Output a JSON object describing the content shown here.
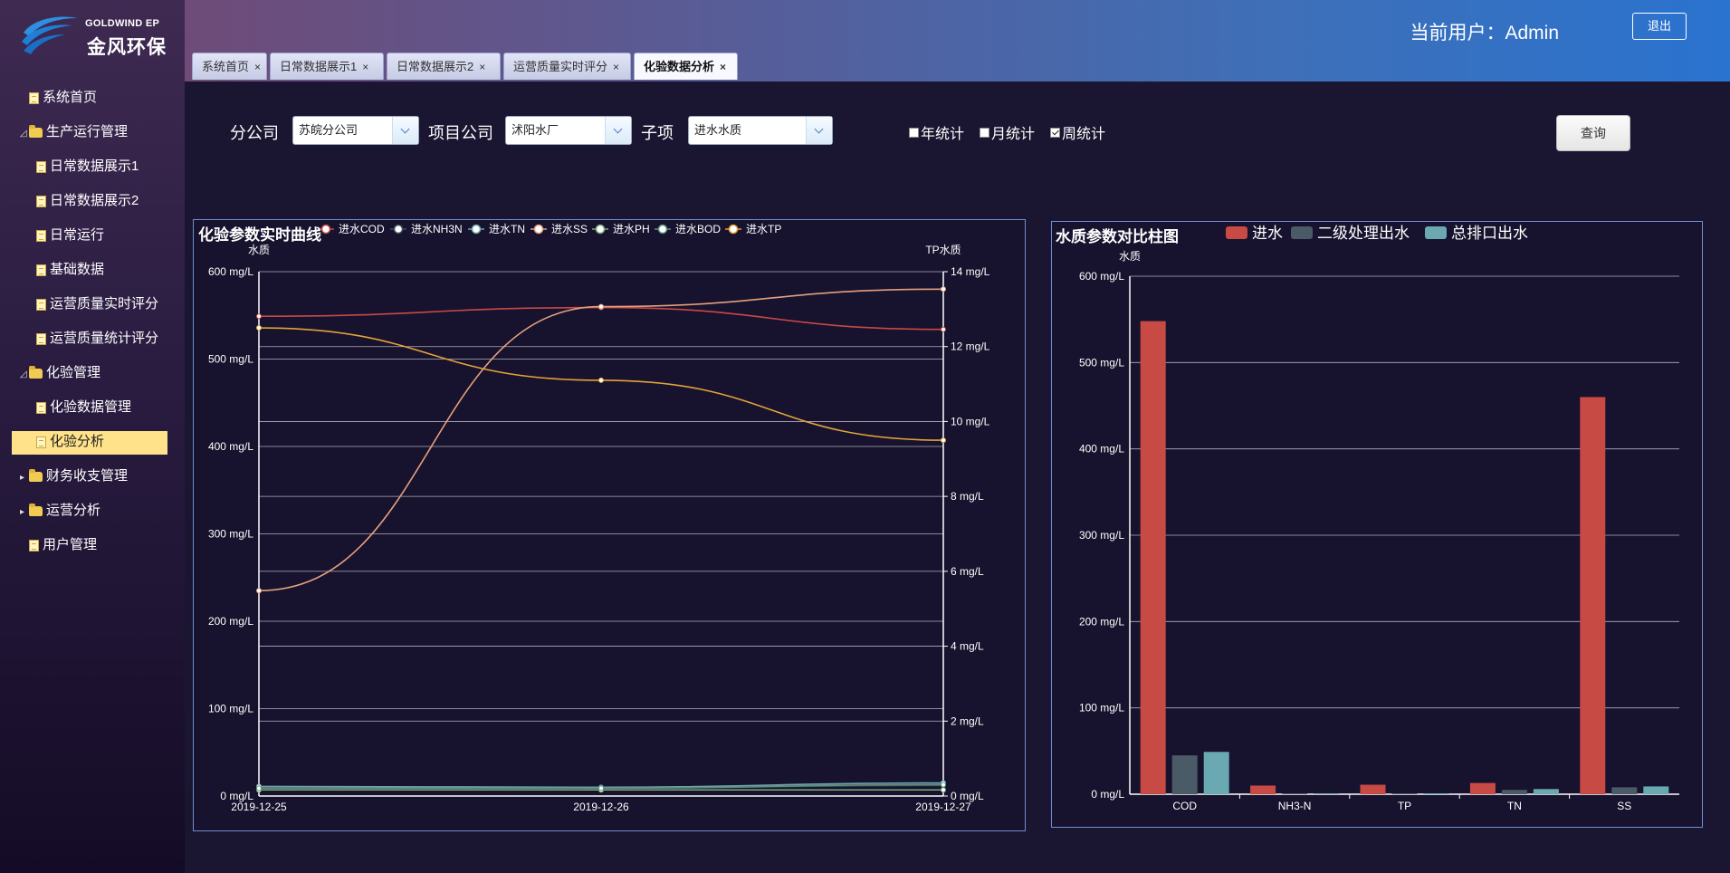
{
  "brand": {
    "en": "GOLDWIND EP",
    "cn": "金风环保"
  },
  "header": {
    "user_label": "当前用户：Admin",
    "logout_label": "退出"
  },
  "sidebar": {
    "items": [
      {
        "label": "系统首页",
        "type": "file",
        "level": 0
      },
      {
        "label": "生产运行管理",
        "type": "folder-open",
        "level": 0,
        "arrow": "◿"
      },
      {
        "label": "日常数据展示1",
        "type": "file",
        "level": 1
      },
      {
        "label": "日常数据展示2",
        "type": "file",
        "level": 1
      },
      {
        "label": "日常运行",
        "type": "file",
        "level": 1
      },
      {
        "label": "基础数据",
        "type": "file",
        "level": 1
      },
      {
        "label": "运营质量实时评分",
        "type": "file",
        "level": 1
      },
      {
        "label": "运营质量统计评分",
        "type": "file",
        "level": 1
      },
      {
        "label": "化验管理",
        "type": "folder-open",
        "level": 0,
        "arrow": "◿"
      },
      {
        "label": "化验数据管理",
        "type": "file",
        "level": 1
      },
      {
        "label": "化验分析",
        "type": "file",
        "level": 1,
        "active": true
      },
      {
        "label": "财务收支管理",
        "type": "folder",
        "level": 0,
        "arrow": "▸"
      },
      {
        "label": "运营分析",
        "type": "folder",
        "level": 0,
        "arrow": "▸"
      },
      {
        "label": "用户管理",
        "type": "file",
        "level": 0
      }
    ]
  },
  "tabs": [
    {
      "label": "系统首页"
    },
    {
      "label": "日常数据展示1"
    },
    {
      "label": "日常数据展示2"
    },
    {
      "label": "运营质量实时评分"
    },
    {
      "label": "化验数据分析",
      "active": true
    }
  ],
  "filters": {
    "branch_label": "分公司",
    "branch_value": "苏皖分公司",
    "project_label": "项目公司",
    "project_value": "沭阳水厂",
    "sub_label": "子项",
    "sub_value": "进水水质",
    "year_label": "年统计",
    "month_label": "月统计",
    "week_label": "周统计",
    "year_checked": false,
    "month_checked": false,
    "week_checked": true,
    "query_label": "查询"
  },
  "line_panel": {
    "title": "化验参数实时曲线"
  },
  "bar_panel": {
    "title": "水质参数对比柱图"
  },
  "chart_data": [
    {
      "type": "line",
      "title": "化验参数实时曲线",
      "x": [
        "2019-12-25",
        "2019-12-26",
        "2019-12-27"
      ],
      "y_left": {
        "label": "水质",
        "ticks": [
          "0 mg/L",
          "100 mg/L",
          "200 mg/L",
          "300 mg/L",
          "400 mg/L",
          "500 mg/L",
          "600 mg/L"
        ],
        "lim": [
          0,
          600
        ]
      },
      "y_right": {
        "label": "TP水质",
        "ticks": [
          "0 mg/L",
          "2 mg/L",
          "4 mg/L",
          "6 mg/L",
          "8 mg/L",
          "10 mg/L",
          "12 mg/L",
          "14 mg/L"
        ],
        "lim": [
          0,
          14
        ]
      },
      "legend_position": "top",
      "grid": true,
      "series": [
        {
          "name": "进水COD",
          "axis": "left",
          "color": "#c84a45",
          "values": [
            549,
            559,
            534
          ]
        },
        {
          "name": "进水NH3N",
          "axis": "left",
          "color": "#3c4f5c",
          "values": [
            10,
            9,
            12
          ]
        },
        {
          "name": "进水TN",
          "axis": "left",
          "color": "#6ba5ad",
          "values": [
            11,
            10,
            15
          ]
        },
        {
          "name": "进水SS",
          "axis": "left",
          "color": "#e4a07e",
          "values": [
            235,
            560,
            580
          ]
        },
        {
          "name": "进水PH",
          "axis": "left",
          "color": "#7ea97a",
          "values": [
            7,
            7,
            7
          ]
        },
        {
          "name": "进水BOD",
          "axis": "left",
          "color": "#5e8f7f",
          "values": [
            9,
            9,
            13
          ]
        },
        {
          "name": "进水TP",
          "axis": "right",
          "color": "#e3a33a",
          "values": [
            12.5,
            11.1,
            9.5
          ]
        }
      ]
    },
    {
      "type": "bar",
      "title": "水质参数对比柱图",
      "categories": [
        "COD",
        "NH3-N",
        "TP",
        "TN",
        "SS"
      ],
      "y_label": "水质",
      "y_ticks": [
        "0 mg/L",
        "100 mg/L",
        "200 mg/L",
        "300 mg/L",
        "400 mg/L",
        "500 mg/L",
        "600 mg/L"
      ],
      "ylim": [
        0,
        600
      ],
      "legend_position": "top",
      "grid": true,
      "series": [
        {
          "name": "进水",
          "color": "#c84a45",
          "values": [
            548,
            10,
            11,
            13,
            460
          ]
        },
        {
          "name": "二级处理出水",
          "color": "#4a5a66",
          "values": [
            45,
            1,
            1,
            5,
            8
          ]
        },
        {
          "name": "总排口出水",
          "color": "#6aa9b1",
          "values": [
            49,
            1,
            1,
            6,
            9
          ]
        }
      ]
    }
  ]
}
